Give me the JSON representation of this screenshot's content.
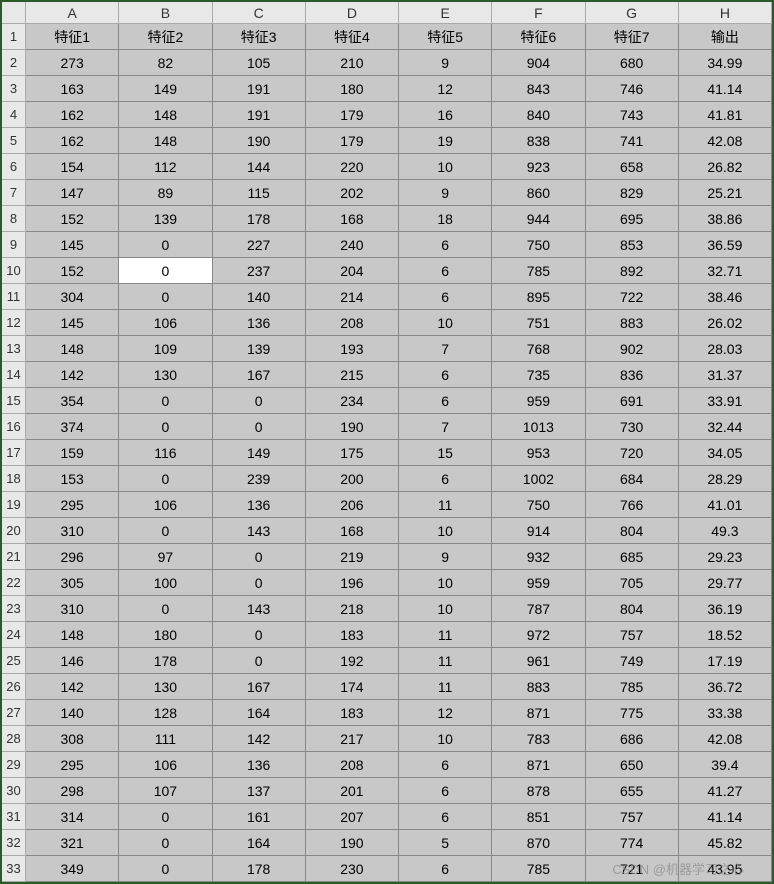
{
  "columns": [
    "A",
    "B",
    "C",
    "D",
    "E",
    "F",
    "G",
    "H"
  ],
  "header_row": [
    "特征1",
    "特征2",
    "特征3",
    "特征4",
    "特征5",
    "特征6",
    "特征7",
    "输出"
  ],
  "rows": [
    [
      "273",
      "82",
      "105",
      "210",
      "9",
      "904",
      "680",
      "34.99"
    ],
    [
      "163",
      "149",
      "191",
      "180",
      "12",
      "843",
      "746",
      "41.14"
    ],
    [
      "162",
      "148",
      "191",
      "179",
      "16",
      "840",
      "743",
      "41.81"
    ],
    [
      "162",
      "148",
      "190",
      "179",
      "19",
      "838",
      "741",
      "42.08"
    ],
    [
      "154",
      "112",
      "144",
      "220",
      "10",
      "923",
      "658",
      "26.82"
    ],
    [
      "147",
      "89",
      "115",
      "202",
      "9",
      "860",
      "829",
      "25.21"
    ],
    [
      "152",
      "139",
      "178",
      "168",
      "18",
      "944",
      "695",
      "38.86"
    ],
    [
      "145",
      "0",
      "227",
      "240",
      "6",
      "750",
      "853",
      "36.59"
    ],
    [
      "152",
      "0",
      "237",
      "204",
      "6",
      "785",
      "892",
      "32.71"
    ],
    [
      "304",
      "0",
      "140",
      "214",
      "6",
      "895",
      "722",
      "38.46"
    ],
    [
      "145",
      "106",
      "136",
      "208",
      "10",
      "751",
      "883",
      "26.02"
    ],
    [
      "148",
      "109",
      "139",
      "193",
      "7",
      "768",
      "902",
      "28.03"
    ],
    [
      "142",
      "130",
      "167",
      "215",
      "6",
      "735",
      "836",
      "31.37"
    ],
    [
      "354",
      "0",
      "0",
      "234",
      "6",
      "959",
      "691",
      "33.91"
    ],
    [
      "374",
      "0",
      "0",
      "190",
      "7",
      "1013",
      "730",
      "32.44"
    ],
    [
      "159",
      "116",
      "149",
      "175",
      "15",
      "953",
      "720",
      "34.05"
    ],
    [
      "153",
      "0",
      "239",
      "200",
      "6",
      "1002",
      "684",
      "28.29"
    ],
    [
      "295",
      "106",
      "136",
      "206",
      "11",
      "750",
      "766",
      "41.01"
    ],
    [
      "310",
      "0",
      "143",
      "168",
      "10",
      "914",
      "804",
      "49.3"
    ],
    [
      "296",
      "97",
      "0",
      "219",
      "9",
      "932",
      "685",
      "29.23"
    ],
    [
      "305",
      "100",
      "0",
      "196",
      "10",
      "959",
      "705",
      "29.77"
    ],
    [
      "310",
      "0",
      "143",
      "218",
      "10",
      "787",
      "804",
      "36.19"
    ],
    [
      "148",
      "180",
      "0",
      "183",
      "11",
      "972",
      "757",
      "18.52"
    ],
    [
      "146",
      "178",
      "0",
      "192",
      "11",
      "961",
      "749",
      "17.19"
    ],
    [
      "142",
      "130",
      "167",
      "174",
      "11",
      "883",
      "785",
      "36.72"
    ],
    [
      "140",
      "128",
      "164",
      "183",
      "12",
      "871",
      "775",
      "33.38"
    ],
    [
      "308",
      "111",
      "142",
      "217",
      "10",
      "783",
      "686",
      "42.08"
    ],
    [
      "295",
      "106",
      "136",
      "208",
      "6",
      "871",
      "650",
      "39.4"
    ],
    [
      "298",
      "107",
      "137",
      "201",
      "6",
      "878",
      "655",
      "41.27"
    ],
    [
      "314",
      "0",
      "161",
      "207",
      "6",
      "851",
      "757",
      "41.14"
    ],
    [
      "321",
      "0",
      "164",
      "190",
      "5",
      "870",
      "774",
      "45.82"
    ],
    [
      "349",
      "0",
      "178",
      "230",
      "6",
      "785",
      "721",
      "43.95"
    ]
  ],
  "active_cell": {
    "row_index": 8,
    "col_index": 1
  },
  "watermark": "CSDN @机器学习之心"
}
